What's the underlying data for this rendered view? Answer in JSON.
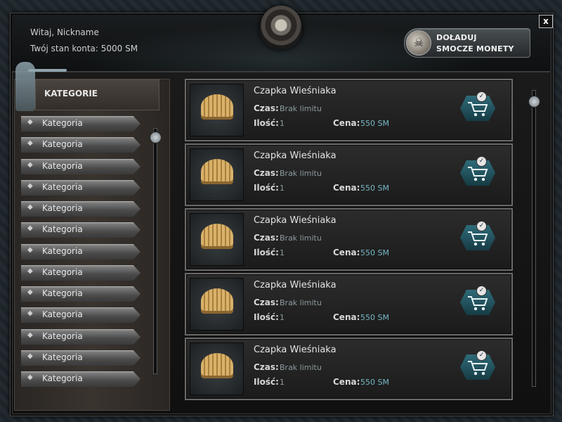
{
  "header": {
    "welcome": "Witaj, Nickname",
    "balance": "Twój stan konta: 5000 SM",
    "topup_line1": "DOŁADUJ",
    "topup_line2": "SMOCZE MONETY",
    "close_label": "x"
  },
  "sidebar": {
    "title": "KATEGORIE",
    "items": [
      {
        "label": "Kategoria"
      },
      {
        "label": "Kategoria"
      },
      {
        "label": "Kategoria"
      },
      {
        "label": "Kategoria"
      },
      {
        "label": "Kategoria"
      },
      {
        "label": "Kategoria"
      },
      {
        "label": "Kategoria"
      },
      {
        "label": "Kategoria"
      },
      {
        "label": "Kategoria"
      },
      {
        "label": "Kategoria"
      },
      {
        "label": "Kategoria"
      },
      {
        "label": "Kategoria"
      },
      {
        "label": "Kategoria"
      }
    ]
  },
  "items": [
    {
      "name": "Czapka Wieśniaka",
      "time_label": "Czas:",
      "time": "Brak limitu",
      "qty_label": "Ilość:",
      "qty": "1",
      "price_label": "Cena:",
      "price": "550 SM"
    },
    {
      "name": "Czapka Wieśniaka",
      "time_label": "Czas:",
      "time": "Brak limitu",
      "qty_label": "Ilość:",
      "qty": "1",
      "price_label": "Cena:",
      "price": "550 SM"
    },
    {
      "name": "Czapka Wieśniaka",
      "time_label": "Czas:",
      "time": "Brak limitu",
      "qty_label": "Ilość:",
      "qty": "1",
      "price_label": "Cena:",
      "price": "550 SM"
    },
    {
      "name": "Czapka Wieśniaka",
      "time_label": "Czas:",
      "time": "Brak limitu",
      "qty_label": "Ilość:",
      "qty": "1",
      "price_label": "Cena:",
      "price": "550 SM"
    },
    {
      "name": "Czapka Wieśniaka",
      "time_label": "Czas:",
      "time": "Brak limitu",
      "qty_label": "Ilość:",
      "qty": "1",
      "price_label": "Cena:",
      "price": "550 SM"
    }
  ],
  "icons": {
    "item": "shell-hat-icon",
    "buy": "shopping-cart-icon",
    "topup": "skull-coin-icon",
    "crest": "skull-crest-icon",
    "close": "close-icon"
  },
  "colors": {
    "price": "#74b8c4",
    "cart_button": "#2f6b79"
  }
}
